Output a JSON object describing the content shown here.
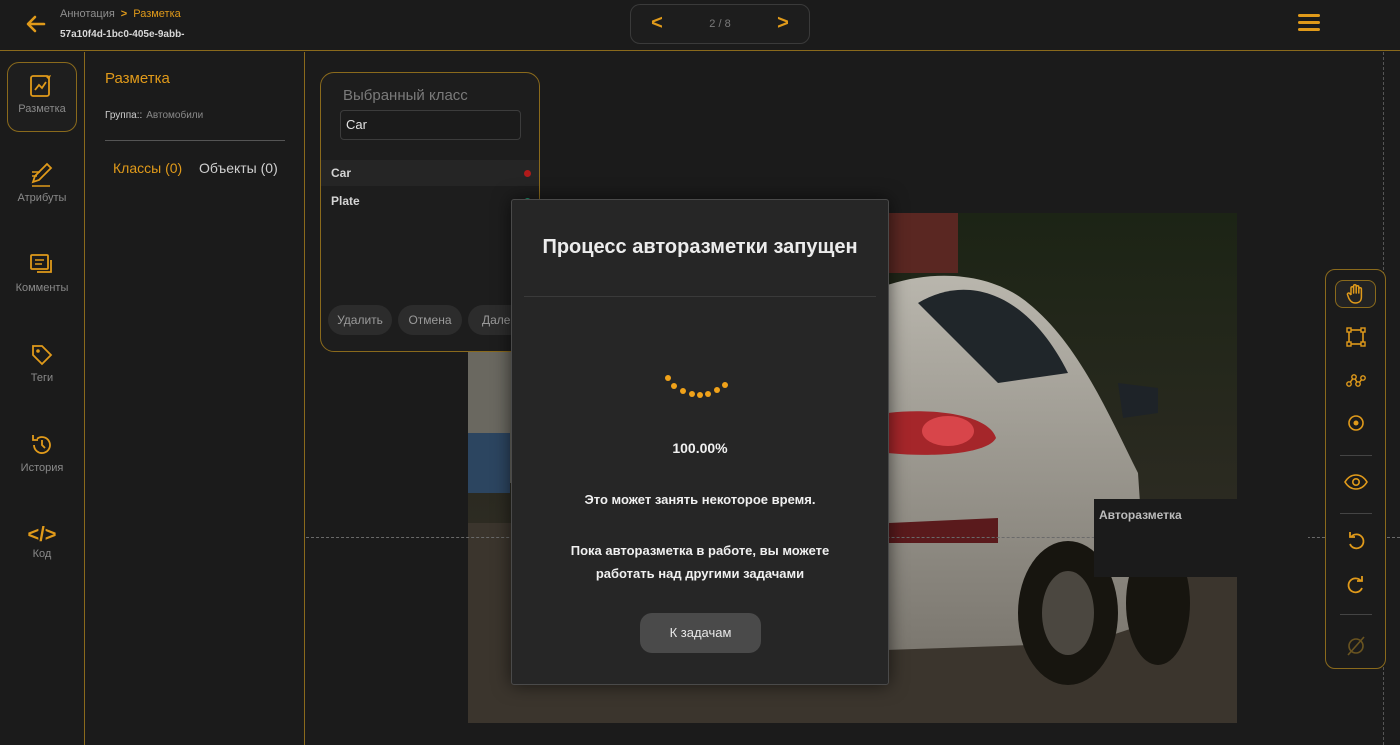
{
  "header": {
    "breadcrumb_parent": "Аннотация",
    "breadcrumb_sep": ">",
    "breadcrumb_current": "Разметка",
    "doc_id": "57a10f4d-1bc0-405e-9abb-",
    "pager_prev": "<",
    "pager_next": ">",
    "pager_count": "2 / 8"
  },
  "leftnav": {
    "items": [
      {
        "label": "Разметка",
        "icon": "markup-icon"
      },
      {
        "label": "Атрибуты",
        "icon": "pen-icon"
      },
      {
        "label": "Комменты",
        "icon": "comments-icon"
      },
      {
        "label": "Теги",
        "icon": "tag-icon"
      },
      {
        "label": "История",
        "icon": "history-icon"
      },
      {
        "label": "Код",
        "icon": "code-icon",
        "glyph": "</>"
      }
    ]
  },
  "sidepanel": {
    "title": "Разметка",
    "group_label": "Группа::",
    "group_value": "Автомобили",
    "tab_classes": "Классы (0)",
    "tab_objects": "Объекты (0)"
  },
  "classcard": {
    "title": "Выбранный класс",
    "input_value": "Car",
    "classes": [
      {
        "name": "Car",
        "color": "#b01a1a"
      },
      {
        "name": "Plate",
        "color": "#1aa37a"
      }
    ],
    "btn_delete": "Удалить",
    "btn_cancel": "Отмена",
    "btn_next": "Далее"
  },
  "tooltip": {
    "text": "Авторазметка"
  },
  "toolbar": {
    "tools": [
      "hand-icon",
      "bbox-icon",
      "polyline-icon",
      "point-icon",
      "eye-icon",
      "undo-icon",
      "redo-icon",
      "hide-icon"
    ],
    "accent": "#e09a1a"
  },
  "modal": {
    "title": "Процесс авторазметки запущен",
    "progress": "100.00%",
    "message1": "Это может занять некоторое время.",
    "message2": "Пока авторазметка в работе, вы можете работать над другими задачами",
    "button": "К задачам"
  }
}
